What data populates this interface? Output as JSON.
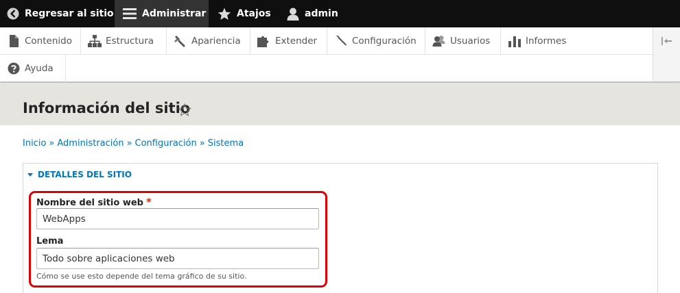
{
  "toolbar": {
    "back_label": "Regresar al sitio",
    "manage_label": "Administrar",
    "shortcuts_label": "Atajos",
    "user_label": "admin"
  },
  "tray": {
    "items": [
      {
        "label": "Contenido",
        "icon": "file-icon"
      },
      {
        "label": "Estructura",
        "icon": "sitemap-icon"
      },
      {
        "label": "Apariencia",
        "icon": "paintbrush-icon"
      },
      {
        "label": "Extender",
        "icon": "puzzle-icon"
      },
      {
        "label": "Configuración",
        "icon": "wrench-icon"
      },
      {
        "label": "Usuarios",
        "icon": "people-icon"
      },
      {
        "label": "Informes",
        "icon": "bar-chart-icon"
      }
    ],
    "help": {
      "label": "Ayuda",
      "icon": "question-icon"
    }
  },
  "page": {
    "title": "Información del sitio"
  },
  "breadcrumb": {
    "items": [
      "Inicio",
      "Administración",
      "Configuración",
      "Sistema"
    ],
    "separator": "»"
  },
  "details": {
    "summary": "DETALLES DEL SITIO",
    "site_name": {
      "label": "Nombre del sitio web",
      "required_mark": "*",
      "value": "WebApps"
    },
    "slogan": {
      "label": "Lema",
      "value": "Todo sobre aplicaciones web",
      "description": "Cómo se use esto depende del tema gráfico de su sitio."
    }
  },
  "colors": {
    "toolbar_bg": "#0f0f0f",
    "link": "#0074bd",
    "header_bg": "#e5e4df",
    "highlight": "#e00000"
  }
}
